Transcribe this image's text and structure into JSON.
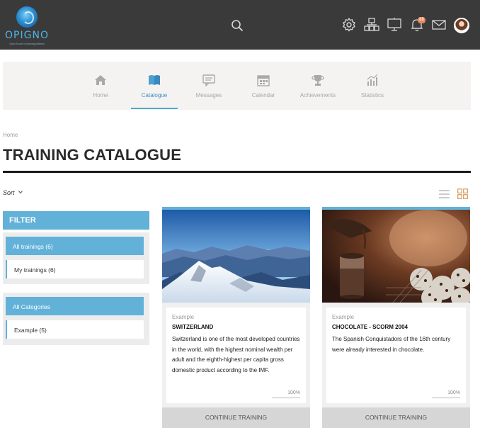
{
  "header": {
    "logo_text": "OPIGNO",
    "logo_tagline": "Open Source e-learning platform",
    "notification_count": "88",
    "icons": [
      "search-icon",
      "gear-icon",
      "org-chart-icon",
      "presentation-icon",
      "bell-icon",
      "mail-icon",
      "avatar"
    ]
  },
  "nav": {
    "items": [
      {
        "label": "Home",
        "icon": "home-icon"
      },
      {
        "label": "Catalogue",
        "icon": "book-icon",
        "active": true
      },
      {
        "label": "Messages",
        "icon": "message-icon"
      },
      {
        "label": "Calendar",
        "icon": "calendar-icon"
      },
      {
        "label": "Achievements",
        "icon": "trophy-icon"
      },
      {
        "label": "Statistics",
        "icon": "stats-icon"
      }
    ]
  },
  "breadcrumb": "Home",
  "page_title": "TRAINING CATALOGUE",
  "sort_label": "Sort",
  "filter": {
    "title": "FILTER",
    "group1": [
      "All trainings (6)",
      "My trainings (6)"
    ],
    "group2": [
      "All Categories",
      "Example (5)"
    ]
  },
  "cards": [
    {
      "category": "Example",
      "title": "SWITZERLAND",
      "description": "Switzerland is one of the most developed countries in the world, with the highest nominal wealth per adult and the eighth-highest per capita gross domestic product according to the IMF.",
      "progress_label": "100%",
      "progress": 1.0,
      "cta": "CONTINUE TRAINING",
      "image": "mountains-image"
    },
    {
      "category": "Example",
      "title": "CHOCOLATE - SCORM 2004",
      "description": "The Spanish Conquistadors of the 16th century were already interested in chocolate.",
      "progress_label": "100%",
      "progress": 1.0,
      "cta": "CONTINUE TRAINING",
      "image": "chocolate-image"
    }
  ],
  "colors": {
    "topbar": "#3a3a3a",
    "accent": "#62b1d9",
    "nav_active": "#3c8fc4"
  }
}
